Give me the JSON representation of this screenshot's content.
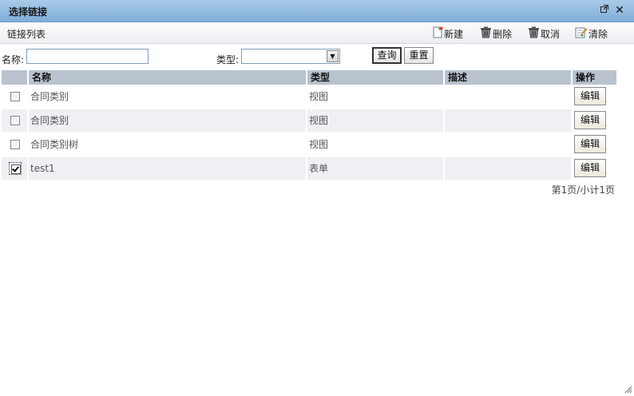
{
  "window": {
    "title": "选择链接",
    "restore_icon": "restore-window-icon",
    "close_icon": "close-icon"
  },
  "toolbar": {
    "title": "链接列表",
    "new_label": "新建",
    "delete_label": "删除",
    "cancel_label": "取消",
    "clear_label": "清除"
  },
  "search": {
    "name_label": "名称:",
    "name_value": "",
    "type_label": "类型:",
    "type_value": "",
    "query_label": "查询",
    "reset_label": "重置"
  },
  "table": {
    "columns": [
      "名称",
      "类型",
      "描述",
      "操作"
    ],
    "rows": [
      {
        "checked": false,
        "name": "合同类别",
        "type": "视图",
        "desc": "",
        "action": "编辑"
      },
      {
        "checked": false,
        "name": "合同类别",
        "type": "视图",
        "desc": "",
        "action": "编辑"
      },
      {
        "checked": false,
        "name": "合同类别树",
        "type": "视图",
        "desc": "",
        "action": "编辑"
      },
      {
        "checked": true,
        "name": "test1",
        "type": "表单",
        "desc": "",
        "action": "编辑"
      }
    ]
  },
  "pager": {
    "text": "第1页/小计1页"
  },
  "colors": {
    "titlebar": "#7faed9",
    "header_bg": "#b9c3cd",
    "alt_row": "#eef0f3"
  }
}
